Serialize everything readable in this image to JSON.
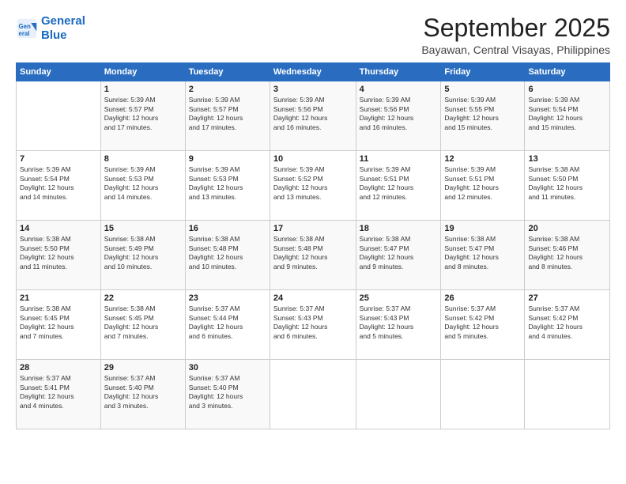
{
  "header": {
    "logo_line1": "General",
    "logo_line2": "Blue",
    "month": "September 2025",
    "location": "Bayawan, Central Visayas, Philippines"
  },
  "weekdays": [
    "Sunday",
    "Monday",
    "Tuesday",
    "Wednesday",
    "Thursday",
    "Friday",
    "Saturday"
  ],
  "weeks": [
    [
      {
        "day": "",
        "info": ""
      },
      {
        "day": "1",
        "info": "Sunrise: 5:39 AM\nSunset: 5:57 PM\nDaylight: 12 hours\nand 17 minutes."
      },
      {
        "day": "2",
        "info": "Sunrise: 5:39 AM\nSunset: 5:57 PM\nDaylight: 12 hours\nand 17 minutes."
      },
      {
        "day": "3",
        "info": "Sunrise: 5:39 AM\nSunset: 5:56 PM\nDaylight: 12 hours\nand 16 minutes."
      },
      {
        "day": "4",
        "info": "Sunrise: 5:39 AM\nSunset: 5:56 PM\nDaylight: 12 hours\nand 16 minutes."
      },
      {
        "day": "5",
        "info": "Sunrise: 5:39 AM\nSunset: 5:55 PM\nDaylight: 12 hours\nand 15 minutes."
      },
      {
        "day": "6",
        "info": "Sunrise: 5:39 AM\nSunset: 5:54 PM\nDaylight: 12 hours\nand 15 minutes."
      }
    ],
    [
      {
        "day": "7",
        "info": "Sunrise: 5:39 AM\nSunset: 5:54 PM\nDaylight: 12 hours\nand 14 minutes."
      },
      {
        "day": "8",
        "info": "Sunrise: 5:39 AM\nSunset: 5:53 PM\nDaylight: 12 hours\nand 14 minutes."
      },
      {
        "day": "9",
        "info": "Sunrise: 5:39 AM\nSunset: 5:53 PM\nDaylight: 12 hours\nand 13 minutes."
      },
      {
        "day": "10",
        "info": "Sunrise: 5:39 AM\nSunset: 5:52 PM\nDaylight: 12 hours\nand 13 minutes."
      },
      {
        "day": "11",
        "info": "Sunrise: 5:39 AM\nSunset: 5:51 PM\nDaylight: 12 hours\nand 12 minutes."
      },
      {
        "day": "12",
        "info": "Sunrise: 5:39 AM\nSunset: 5:51 PM\nDaylight: 12 hours\nand 12 minutes."
      },
      {
        "day": "13",
        "info": "Sunrise: 5:38 AM\nSunset: 5:50 PM\nDaylight: 12 hours\nand 11 minutes."
      }
    ],
    [
      {
        "day": "14",
        "info": "Sunrise: 5:38 AM\nSunset: 5:50 PM\nDaylight: 12 hours\nand 11 minutes."
      },
      {
        "day": "15",
        "info": "Sunrise: 5:38 AM\nSunset: 5:49 PM\nDaylight: 12 hours\nand 10 minutes."
      },
      {
        "day": "16",
        "info": "Sunrise: 5:38 AM\nSunset: 5:48 PM\nDaylight: 12 hours\nand 10 minutes."
      },
      {
        "day": "17",
        "info": "Sunrise: 5:38 AM\nSunset: 5:48 PM\nDaylight: 12 hours\nand 9 minutes."
      },
      {
        "day": "18",
        "info": "Sunrise: 5:38 AM\nSunset: 5:47 PM\nDaylight: 12 hours\nand 9 minutes."
      },
      {
        "day": "19",
        "info": "Sunrise: 5:38 AM\nSunset: 5:47 PM\nDaylight: 12 hours\nand 8 minutes."
      },
      {
        "day": "20",
        "info": "Sunrise: 5:38 AM\nSunset: 5:46 PM\nDaylight: 12 hours\nand 8 minutes."
      }
    ],
    [
      {
        "day": "21",
        "info": "Sunrise: 5:38 AM\nSunset: 5:45 PM\nDaylight: 12 hours\nand 7 minutes."
      },
      {
        "day": "22",
        "info": "Sunrise: 5:38 AM\nSunset: 5:45 PM\nDaylight: 12 hours\nand 7 minutes."
      },
      {
        "day": "23",
        "info": "Sunrise: 5:37 AM\nSunset: 5:44 PM\nDaylight: 12 hours\nand 6 minutes."
      },
      {
        "day": "24",
        "info": "Sunrise: 5:37 AM\nSunset: 5:43 PM\nDaylight: 12 hours\nand 6 minutes."
      },
      {
        "day": "25",
        "info": "Sunrise: 5:37 AM\nSunset: 5:43 PM\nDaylight: 12 hours\nand 5 minutes."
      },
      {
        "day": "26",
        "info": "Sunrise: 5:37 AM\nSunset: 5:42 PM\nDaylight: 12 hours\nand 5 minutes."
      },
      {
        "day": "27",
        "info": "Sunrise: 5:37 AM\nSunset: 5:42 PM\nDaylight: 12 hours\nand 4 minutes."
      }
    ],
    [
      {
        "day": "28",
        "info": "Sunrise: 5:37 AM\nSunset: 5:41 PM\nDaylight: 12 hours\nand 4 minutes."
      },
      {
        "day": "29",
        "info": "Sunrise: 5:37 AM\nSunset: 5:40 PM\nDaylight: 12 hours\nand 3 minutes."
      },
      {
        "day": "30",
        "info": "Sunrise: 5:37 AM\nSunset: 5:40 PM\nDaylight: 12 hours\nand 3 minutes."
      },
      {
        "day": "",
        "info": ""
      },
      {
        "day": "",
        "info": ""
      },
      {
        "day": "",
        "info": ""
      },
      {
        "day": "",
        "info": ""
      }
    ]
  ]
}
